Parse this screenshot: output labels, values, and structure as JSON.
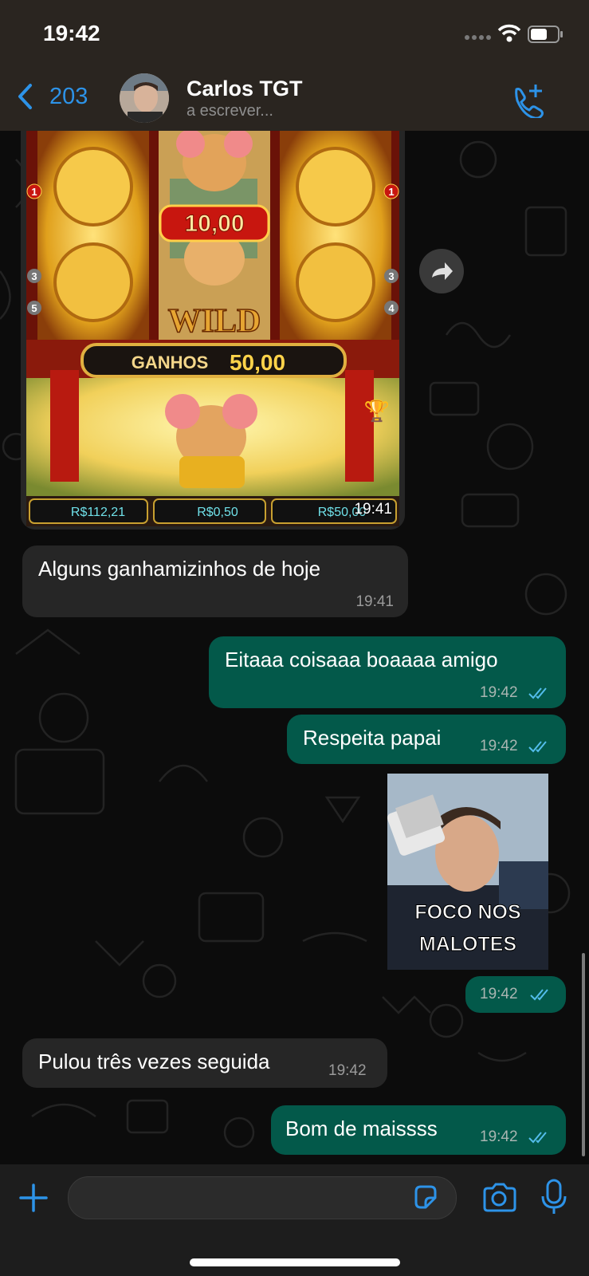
{
  "status": {
    "time": "19:42"
  },
  "header": {
    "back_count": "203",
    "contact_name": "Carlos TGT",
    "contact_status": "a escrever..."
  },
  "messages": [
    {
      "type": "image",
      "dir": "in",
      "time": "19:41",
      "image_text": {
        "multiplier": "10,00",
        "wild": "WILD",
        "win_label": "GANHOS",
        "win_value": "50,00",
        "balance": "R$112,21",
        "bet": "R$0,50",
        "last_win": "R$50,00",
        "row_numbers_left": [
          "1",
          "3",
          "5"
        ],
        "row_numbers_right": [
          "1",
          "3",
          "4"
        ]
      }
    },
    {
      "type": "text",
      "dir": "in",
      "text": "Alguns ganhamizinhos de hoje",
      "time": "19:41"
    },
    {
      "type": "text",
      "dir": "out",
      "text": "Eitaaa coisaaa boaaaa amigo",
      "time": "19:42"
    },
    {
      "type": "text",
      "dir": "out",
      "text": "Respeita papai",
      "time": "19:42"
    },
    {
      "type": "sticker",
      "dir": "out",
      "caption_line1": "FOCO NOS",
      "caption_line2": "MALOTES",
      "time": "19:42"
    },
    {
      "type": "text",
      "dir": "in",
      "text": "Pulou três vezes seguida",
      "time": "19:42"
    },
    {
      "type": "text",
      "dir": "out",
      "text": "Bom de maissss",
      "time": "19:42"
    }
  ],
  "colors": {
    "accent": "#2d93e8",
    "outgoing_bubble": "#03594a",
    "incoming_bubble": "#262626"
  }
}
